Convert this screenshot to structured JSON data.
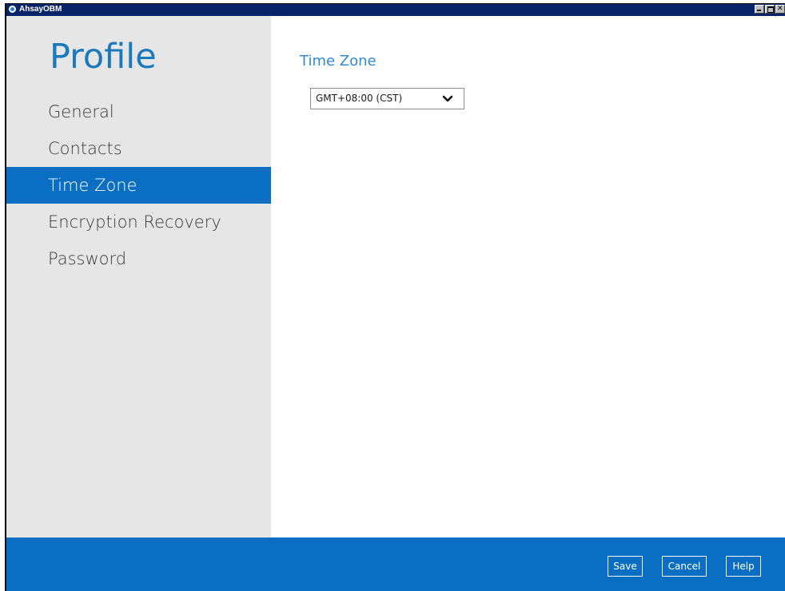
{
  "window": {
    "title": "AhsayOBM"
  },
  "sidebar": {
    "title": "Profile",
    "items": [
      {
        "label": "General",
        "active": false
      },
      {
        "label": "Contacts",
        "active": false
      },
      {
        "label": "Time Zone",
        "active": true
      },
      {
        "label": "Encryption Recovery",
        "active": false
      },
      {
        "label": "Password",
        "active": false
      }
    ]
  },
  "main": {
    "section_title": "Time Zone",
    "timezone_select": {
      "value": "GMT+08:00 (CST)"
    }
  },
  "footer": {
    "save_label": "Save",
    "cancel_label": "Cancel",
    "help_label": "Help"
  },
  "colors": {
    "accent": "#0a6fc2",
    "title_blue": "#1b79bd",
    "sidebar_bg": "#e6e6e6"
  }
}
